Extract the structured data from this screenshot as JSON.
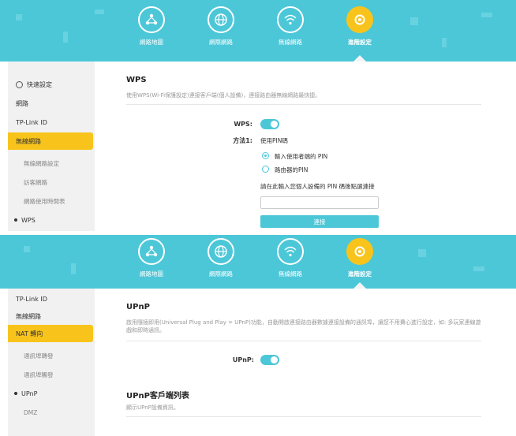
{
  "nav": [
    {
      "label": "網路地圖",
      "icon": "network-map-icon"
    },
    {
      "label": "網際網路",
      "icon": "globe-icon"
    },
    {
      "label": "無線網路",
      "icon": "wifi-icon"
    },
    {
      "label": "進階設定",
      "icon": "advanced-gear-icon",
      "active": true
    }
  ],
  "panel1": {
    "sidebar": {
      "quick_setup": "快速設定",
      "network": "網路",
      "tplink_id": "TP-Link ID",
      "wireless": "無線網路",
      "wireless_settings": "無線網路設定",
      "guest": "訪客網路",
      "schedule": "網路使用時間表",
      "wps": "WPS"
    },
    "title": "WPS",
    "description": "使用WPS(Wi-Fi保護設定)連接客戶端(個人設備)，連接路由器無線網路最快捷。",
    "wps_label": "WPS:",
    "method_label": "方法1:",
    "method_value": "使用PIN碼",
    "option_client_pin": "輸入使用者端的 PIN",
    "option_router_pin": "路由器的PIN",
    "pin_instruction": "請在此輸入您個人設備的 PIN 碼後點選連接",
    "pin_value": "",
    "connect_label": "連接"
  },
  "panel2": {
    "sidebar": {
      "tplink_id": "TP-Link ID",
      "wireless": "無線網路",
      "nat": "NAT 轉向",
      "port_forwarding": "通訊埠轉發",
      "port_triggering": "通訊埠觸發",
      "upnp": "UPnP",
      "dmz": "DMZ"
    },
    "title": "UPnP",
    "description": "啟用隨插即用(Universal Plug and Play = UPnP)功能，自動開啟連接路由器數據連接設備的通訊埠，讓您不用費心進行設定，如: 多玩家連線遊戲和即時通訊。",
    "upnp_label": "UPnP:",
    "client_list_title": "UPnP客戶端列表",
    "client_list_desc": "顯示UPnP設備資訊。"
  },
  "colors": {
    "accent": "#4cc7d8",
    "active": "#f8c41c"
  }
}
